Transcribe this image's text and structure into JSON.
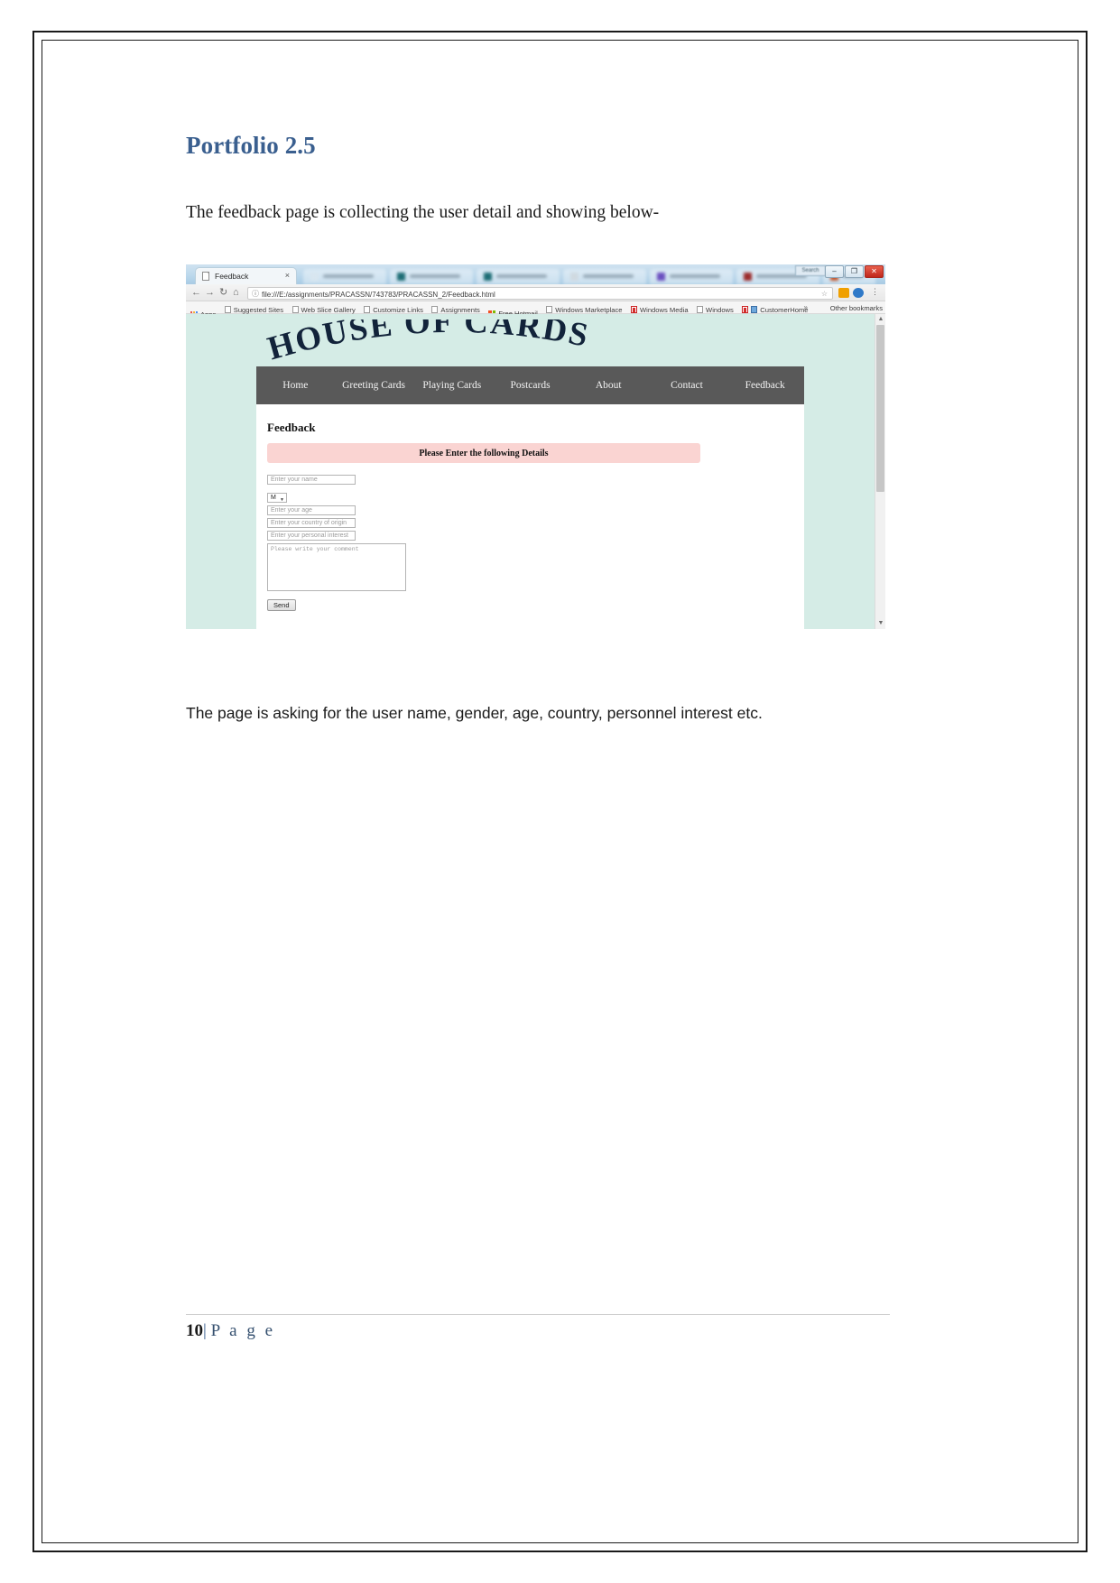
{
  "document": {
    "heading": "Portfolio 2.5",
    "paragraph_above": "The feedback page is collecting the user detail and showing below-",
    "paragraph_below": "The page is asking for the user name, gender, age, country, personnel interest etc.",
    "footer": {
      "page_number": "10",
      "separator": "|",
      "page_word": "P a g e"
    }
  },
  "browser": {
    "active_tab": {
      "title": "Feedback",
      "close_label": "×"
    },
    "window_controls": {
      "minimize": "–",
      "maximize": "❐",
      "close": "✕",
      "search_box": "Search"
    },
    "toolbar": {
      "back": "←",
      "forward": "→",
      "reload": "↻",
      "home": "⌂",
      "security_icon": "ⓘ",
      "url": "file:///E:/assignments/PRACASSN/743783/PRACASSN_2/Feedback.html",
      "star": "☆",
      "menu": "⋮"
    },
    "bookmarks": [
      {
        "label": "Apps",
        "icon": "apps-grid-icon"
      },
      {
        "label": "Suggested Sites",
        "icon": "page-icon"
      },
      {
        "label": "Web Slice Gallery",
        "icon": "page-icon"
      },
      {
        "label": "Customize Links",
        "icon": "page-icon"
      },
      {
        "label": "Assignments",
        "icon": "page-icon"
      },
      {
        "label": "Free Hotmail",
        "icon": "microsoft-icon"
      },
      {
        "label": "Windows Marketplace",
        "icon": "page-icon"
      },
      {
        "label": "Windows Media",
        "icon": "media-icon"
      },
      {
        "label": "Windows",
        "icon": "page-icon"
      },
      {
        "label": "CustomerHome",
        "icon": "blue-icon"
      }
    ],
    "bookmarks_overflow": "»",
    "other_bookmarks": "Other bookmarks"
  },
  "webpage": {
    "logo": "HOUSE OF CARDS",
    "nav": [
      "Home",
      "Greeting Cards",
      "Playing Cards",
      "Postcards",
      "About",
      "Contact",
      "Feedback"
    ],
    "page_title": "Feedback",
    "banner": "Please Enter the following Details",
    "form": {
      "name_placeholder": "Enter your name",
      "gender_selected": "M",
      "age_placeholder": "Enter your age",
      "country_placeholder": "Enter your country of origin",
      "interest_placeholder": "Enter your personal interest",
      "comment_placeholder": "Please write your comment",
      "submit_label": "Send"
    }
  },
  "colors": {
    "heading": "#3a5f8f",
    "page_background": "#d5ece6",
    "nav_bar": "#595959",
    "banner": "#fad4d2"
  }
}
